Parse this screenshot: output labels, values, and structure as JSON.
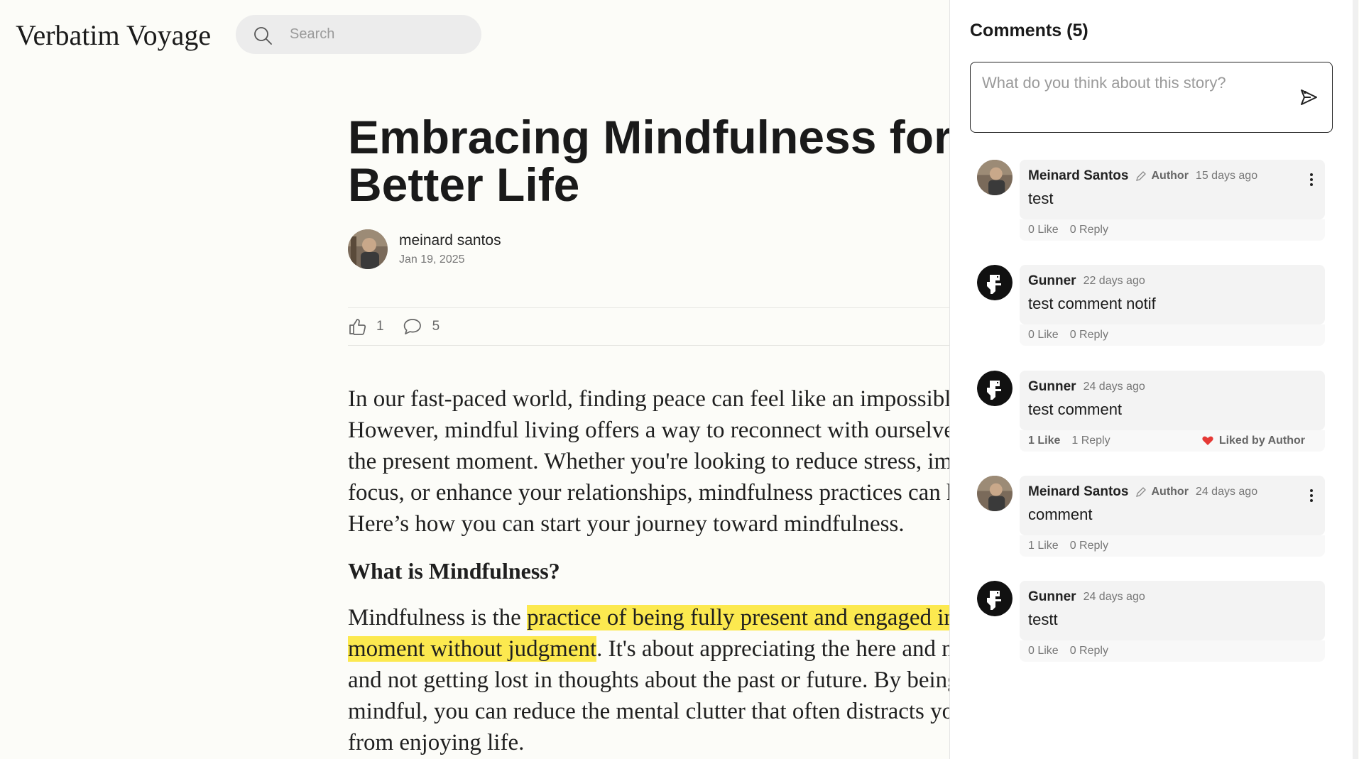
{
  "header": {
    "logo": "Verbatim Voyage",
    "search_placeholder": "Search"
  },
  "article": {
    "title_line1": "Embracing Mindfulness for a",
    "title_line2": "Better Life",
    "author": "meinard santos",
    "date": "Jan 19, 2025",
    "likes": "1",
    "comments": "5",
    "p1_lines": [
      "In our fast-paced world, finding peace can feel like an impossible",
      "However, mindful living offers a way to reconnect with ourselves",
      "the present moment. Whether you're looking to reduce stress, imp",
      "focus, or enhance your relationships, mindfulness practices can h",
      "Here’s how you can start your journey toward mindfulness."
    ],
    "heading": "What is Mindfulness?",
    "p2_start": "Mindfulness is the ",
    "p2_highlight1": "practice of being fully present and engaged in",
    "p2_highlight2": "moment without judgment",
    "p2_after": ". It's about appreciating the here and n",
    "p2_lines": [
      "and not getting lost in thoughts about the past or future. By being",
      "mindful, you can reduce the mental clutter that often distracts yo",
      "from enjoying life."
    ]
  },
  "comments_panel": {
    "title": "Comments (5)",
    "placeholder": "What do you think about this story?",
    "items": [
      {
        "name": "Meinard Santos",
        "author_tag": "Author",
        "time": "15 days ago",
        "text": "test",
        "likes": "0 Like",
        "replies": "0 Reply",
        "liked_by_author": ""
      },
      {
        "name": "Gunner",
        "author_tag": "",
        "time": "22 days ago",
        "text": "test comment notif",
        "likes": "0 Like",
        "replies": "0 Reply",
        "liked_by_author": ""
      },
      {
        "name": "Gunner",
        "author_tag": "",
        "time": "24 days ago",
        "text": "test comment",
        "likes": "1 Like",
        "replies": "1 Reply",
        "liked_by_author": "Liked by Author"
      },
      {
        "name": "Meinard Santos",
        "author_tag": "Author",
        "time": "24 days ago",
        "text": "comment",
        "likes": "1 Like",
        "replies": "0 Reply",
        "liked_by_author": ""
      },
      {
        "name": "Gunner",
        "author_tag": "",
        "time": "24 days ago",
        "text": "testt",
        "likes": "0 Like",
        "replies": "0 Reply",
        "liked_by_author": ""
      }
    ]
  },
  "colors": {
    "highlight": "#fce94f",
    "heart": "#e53935",
    "background": "#fcfcf8"
  }
}
